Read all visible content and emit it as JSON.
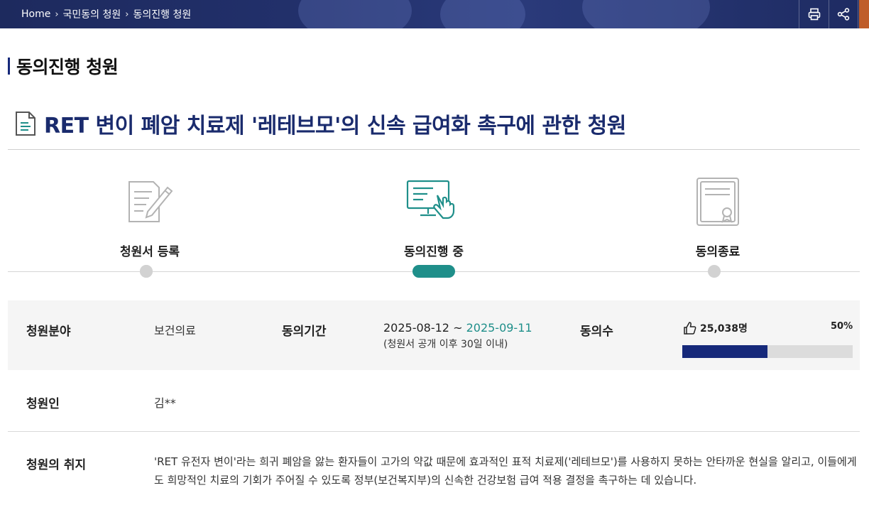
{
  "breadcrumb": {
    "home": "Home",
    "level1": "국민동의 청원",
    "level2": "동의진행 청원",
    "separator": "›"
  },
  "toolbar": {
    "print_icon": "printer-icon",
    "share_icon": "share-icon"
  },
  "section_title": "동의진행 청원",
  "petition": {
    "title": "RET 변이 폐암 치료제 '레테브모'의 신속 급여화 촉구에 관한 청원",
    "icon": "document-icon"
  },
  "steps": [
    {
      "label": "청원서 등록",
      "icon": "pencil-document-icon",
      "active": false
    },
    {
      "label": "동의진행 중",
      "icon": "computer-touch-icon",
      "active": true
    },
    {
      "label": "동의종료",
      "icon": "certificate-icon",
      "active": false
    }
  ],
  "info": {
    "field_label": "청원분야",
    "field_value": "보건의료",
    "period_label": "동의기간",
    "period_start": "2025-08-12 ~",
    "period_end": "2025-09-11",
    "period_note": "(청원서 공개 이후 30일 이내)",
    "count_label": "동의수",
    "count_value": "25,038명",
    "percent_label": "50%",
    "progress_fraction": 0.5,
    "petitioner_label": "청원인",
    "petitioner_value": "김**",
    "purpose_label": "청원의 취지",
    "purpose_text": "'RET 유전자 변이'라는 희귀 폐암을 앓는 환자들이 고가의 약값 때문에 효과적인 표적 치료제('레테브모')를 사용하지 못하는 안타까운 현실을 알리고, 이들에게도 희망적인 치료의 기회가 주어질 수 있도록 정부(보건복지부)의 신속한 건강보험 급여 적용 결정을 촉구하는 데 있습니다."
  },
  "colors": {
    "navy": "#16297a",
    "teal": "#1f8f8a",
    "title_blue": "#1a2b6d",
    "band_gray": "#f5f5f5"
  }
}
